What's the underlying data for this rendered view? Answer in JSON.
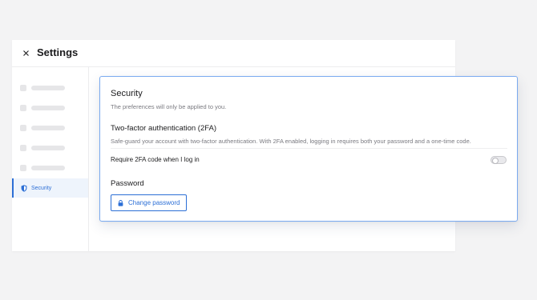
{
  "window": {
    "title": "Settings",
    "close_icon": "close-icon"
  },
  "sidebar": {
    "placeholder_rows": 5,
    "active_item": {
      "label": "Security",
      "icon": "shield-icon"
    }
  },
  "security_card": {
    "title": "Security",
    "subtitle": "The preferences will only be applied to you.",
    "two_factor": {
      "title": "Two-factor authentication (2FA)",
      "description": "Safe-guard your account with two-factor authentication. With 2FA enabled, logging in requires both your password and a one-time code.",
      "require_label": "Require 2FA code when I log in",
      "enabled": false
    },
    "password": {
      "title": "Password",
      "change_button_label": "Change password",
      "change_button_icon": "lock-icon"
    }
  },
  "colors": {
    "accent": "#2c6fd6",
    "card_border": "#7aaaf0",
    "background": "#f3f3f4"
  }
}
